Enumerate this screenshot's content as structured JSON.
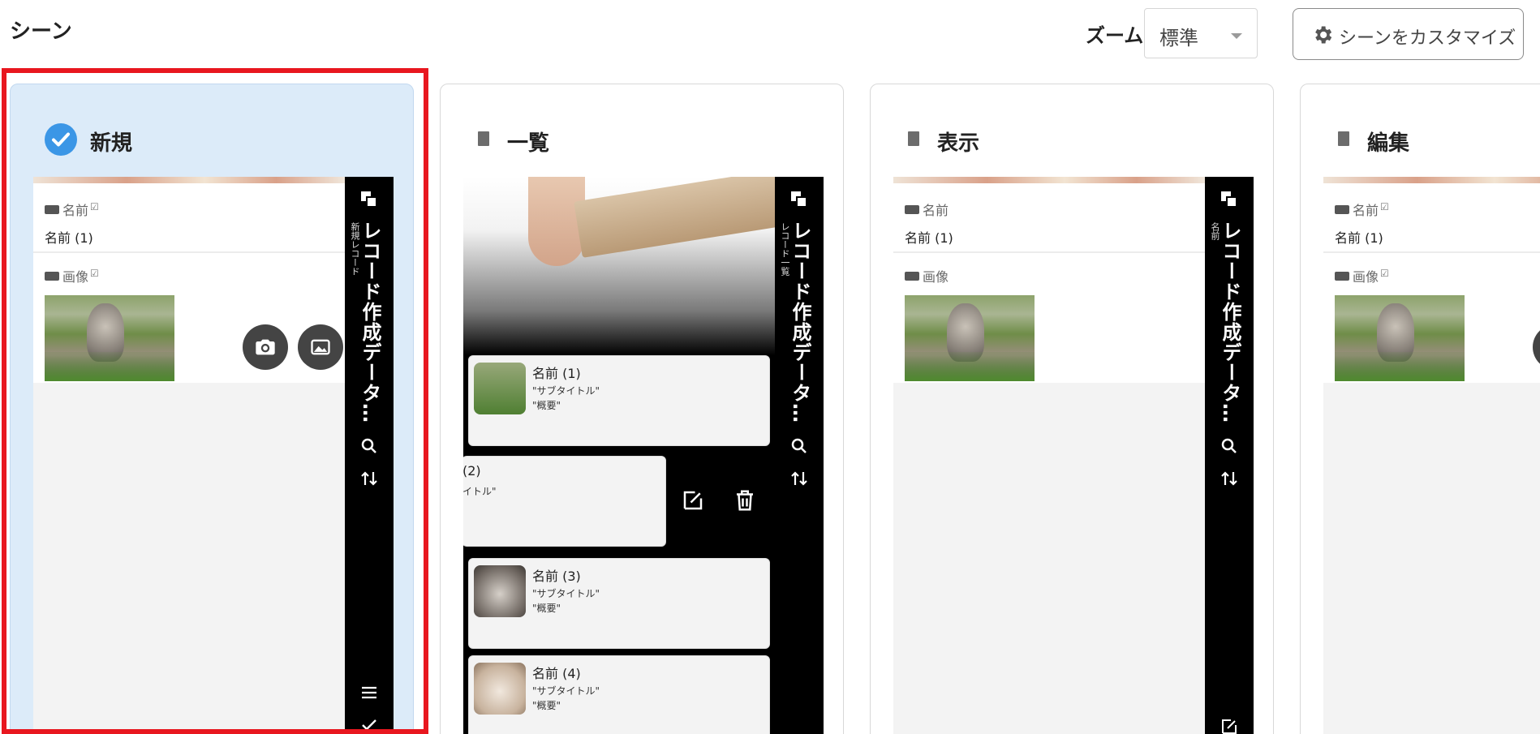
{
  "header": {
    "title": "シーン",
    "zoom_label": "ズーム",
    "zoom_value": "標準",
    "customize_label": "シーンをカスタマイズ"
  },
  "scenes": [
    {
      "name": "新規",
      "selected": true,
      "icon": "check-circle-icon"
    },
    {
      "name": "一覧",
      "selected": false,
      "icon": "document-icon"
    },
    {
      "name": "表示",
      "selected": false,
      "icon": "view-document-icon"
    },
    {
      "name": "編集",
      "selected": false,
      "icon": "edit-document-icon"
    }
  ],
  "phone": {
    "app_title": "レコード作成データ…",
    "subtitles": {
      "new": "新規レコード",
      "list": "レコード一覧",
      "view": "名前",
      "edit": "名前"
    },
    "field_name_label": "名前",
    "field_name_value": "名前 (1)",
    "field_image_label": "画像",
    "list_rows": [
      {
        "title": "名前 (1)",
        "subtitle": "\"サブタイトル\"",
        "summary": "\"概要\""
      },
      {
        "title": "(2)",
        "subtitle": "イトル\"",
        "summary": ""
      },
      {
        "title": "名前 (3)",
        "subtitle": "\"サブタイトル\"",
        "summary": "\"概要\""
      },
      {
        "title": "名前 (4)",
        "subtitle": "\"サブタイトル\"",
        "summary": "\"概要\""
      }
    ]
  },
  "colors": {
    "selected_border": "#e8171f",
    "selected_card_bg": "#dcebf9",
    "check_blue": "#3b96e6",
    "sidebar_bg": "#000000"
  }
}
